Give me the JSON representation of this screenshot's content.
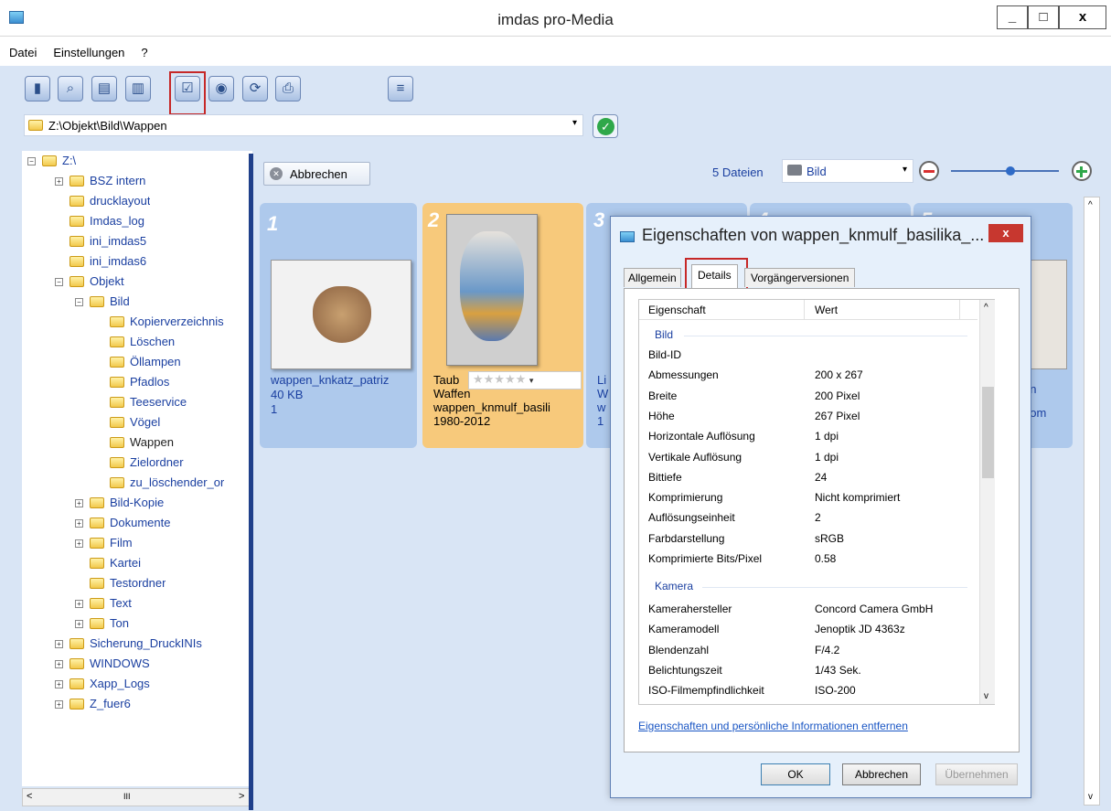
{
  "window": {
    "title": "imdas pro-Media",
    "controls": [
      "_",
      "□",
      "x"
    ]
  },
  "menu": [
    "Datei",
    "Einstellungen",
    "?"
  ],
  "path": {
    "value": "Z:\\Objekt\\Bild\\Wappen"
  },
  "tree": {
    "items": [
      {
        "label": "Z:\\",
        "indent": 0,
        "expander": "−"
      },
      {
        "label": "BSZ intern",
        "indent": 1,
        "expander": "+"
      },
      {
        "label": "drucklayout",
        "indent": 1,
        "expander": ""
      },
      {
        "label": "Imdas_log",
        "indent": 1,
        "expander": ""
      },
      {
        "label": "ini_imdas5",
        "indent": 1,
        "expander": ""
      },
      {
        "label": "ini_imdas6",
        "indent": 1,
        "expander": ""
      },
      {
        "label": "Objekt",
        "indent": 1,
        "expander": "−"
      },
      {
        "label": "Bild",
        "indent": 2,
        "expander": "−"
      },
      {
        "label": "Kopierverzeichnis",
        "indent": 3,
        "expander": ""
      },
      {
        "label": "Löschen",
        "indent": 3,
        "expander": ""
      },
      {
        "label": "Öllampen",
        "indent": 3,
        "expander": ""
      },
      {
        "label": "Pfadlos",
        "indent": 3,
        "expander": ""
      },
      {
        "label": "Teeservice",
        "indent": 3,
        "expander": ""
      },
      {
        "label": "Vögel",
        "indent": 3,
        "expander": ""
      },
      {
        "label": "Wappen",
        "indent": 3,
        "expander": "",
        "selected": true
      },
      {
        "label": "Zielordner",
        "indent": 3,
        "expander": ""
      },
      {
        "label": "zu_löschender_or",
        "indent": 3,
        "expander": ""
      },
      {
        "label": "Bild-Kopie",
        "indent": 2,
        "expander": "+"
      },
      {
        "label": "Dokumente",
        "indent": 2,
        "expander": "+"
      },
      {
        "label": "Film",
        "indent": 2,
        "expander": "+"
      },
      {
        "label": "Kartei",
        "indent": 2,
        "expander": ""
      },
      {
        "label": "Testordner",
        "indent": 2,
        "expander": ""
      },
      {
        "label": "Text",
        "indent": 2,
        "expander": "+"
      },
      {
        "label": "Ton",
        "indent": 2,
        "expander": "+"
      },
      {
        "label": "Sicherung_DruckINIs",
        "indent": 1,
        "expander": "+"
      },
      {
        "label": "WINDOWS",
        "indent": 1,
        "expander": "+"
      },
      {
        "label": "Xapp_Logs",
        "indent": 1,
        "expander": "+"
      },
      {
        "label": "Z_fuer6",
        "indent": 1,
        "expander": "+"
      }
    ],
    "hscroll_mark": "III"
  },
  "main": {
    "cancel_button": "Abbrechen",
    "file_count": "5 Dateien",
    "view_select": "Bild",
    "zoom_level": 0.55,
    "cards": [
      {
        "num": "1",
        "name": "wappen_knkatz_patriz",
        "size": "40 KB",
        "extra": "1"
      },
      {
        "num": "2",
        "line1": "Taub",
        "line2": "Waffen",
        "name": "wappen_knmulf_basili",
        "extra": "1980-2012"
      },
      {
        "num": "3",
        "line1": "Li",
        "line2": "W",
        "name": "w",
        "extra": "1"
      },
      {
        "num": "4"
      },
      {
        "num": "5",
        "line1": "en",
        "line2": "dom"
      }
    ]
  },
  "dialog": {
    "title": "Eigenschaften von wappen_knmulf_basilika_...",
    "tabs": [
      "Allgemein",
      "Details",
      "Vorgängerversionen"
    ],
    "col_property": "Eigenschaft",
    "col_value": "Wert",
    "section_image": "Bild",
    "rows_image": [
      {
        "k": "Bild-ID",
        "v": ""
      },
      {
        "k": "Abmessungen",
        "v": "200 x 267"
      },
      {
        "k": "Breite",
        "v": "200 Pixel"
      },
      {
        "k": "Höhe",
        "v": "267 Pixel"
      },
      {
        "k": "Horizontale Auflösung",
        "v": "1 dpi"
      },
      {
        "k": "Vertikale Auflösung",
        "v": "1 dpi"
      },
      {
        "k": "Bittiefe",
        "v": "24"
      },
      {
        "k": "Komprimierung",
        "v": "Nicht komprimiert"
      },
      {
        "k": "Auflösungseinheit",
        "v": "2"
      },
      {
        "k": "Farbdarstellung",
        "v": "sRGB"
      },
      {
        "k": "Komprimierte Bits/Pixel",
        "v": "0.58"
      }
    ],
    "section_camera": "Kamera",
    "rows_camera": [
      {
        "k": "Kamerahersteller",
        "v": "Concord Camera GmbH"
      },
      {
        "k": "Kameramodell",
        "v": "Jenoptik JD 4363z"
      },
      {
        "k": "Blendenzahl",
        "v": "F/4.2"
      },
      {
        "k": "Belichtungszeit",
        "v": "1/43 Sek."
      },
      {
        "k": "ISO-Filmempfindlichkeit",
        "v": "ISO-200"
      }
    ],
    "link": "Eigenschaften und persönliche Informationen entfernen",
    "ok": "OK",
    "cancel": "Abbrechen",
    "apply": "Übernehmen"
  },
  "colors": {
    "accent_red": "#c62828",
    "link_blue": "#1a56c4",
    "tree_blue": "#1a3fa0",
    "panel_bg": "#d9e5f5"
  }
}
